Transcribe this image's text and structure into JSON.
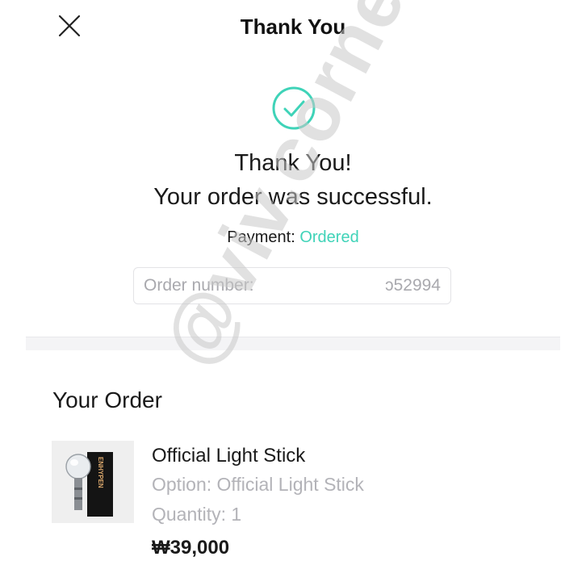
{
  "header": {
    "title": "Thank You",
    "close_icon": "close-icon"
  },
  "confirmation": {
    "icon": "check-circle-icon",
    "accent_color": "#3fd3b8",
    "line1": "Thank You!",
    "line2": "Your order was successful.",
    "payment_label": "Payment: ",
    "payment_status": "Ordered",
    "order_number_label": "Order number:",
    "order_number_value": "ↄ52994"
  },
  "order": {
    "section_title": "Your Order",
    "item": {
      "name": "Official Light Stick",
      "option": "Option: Official Light Stick",
      "quantity": "Quantity: 1",
      "price": "₩39,000",
      "thumbnail_box_text": "ENHYPEN"
    }
  },
  "watermark": "@viv.corner"
}
